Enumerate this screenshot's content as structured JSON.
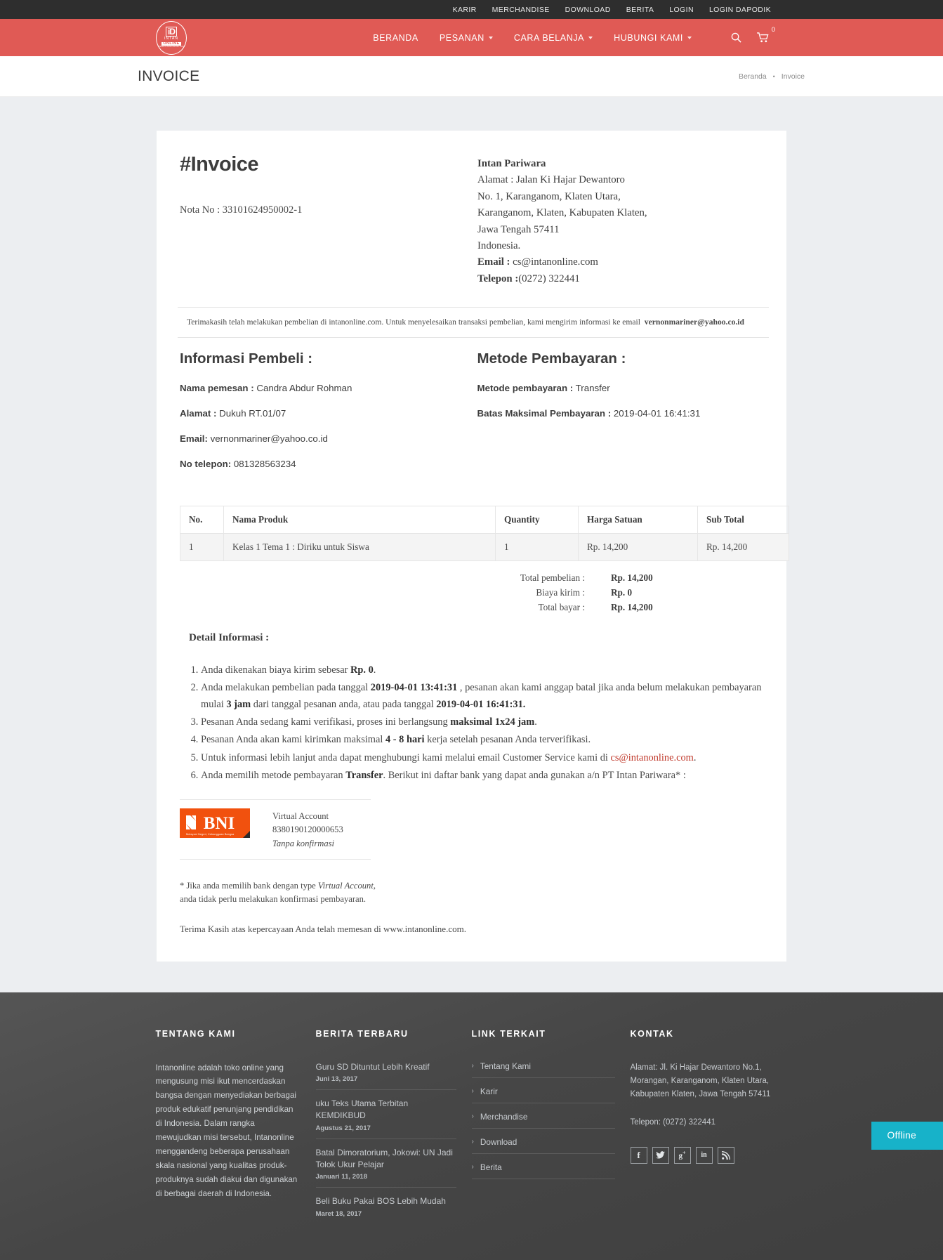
{
  "topbar": {
    "links": [
      "KARIR",
      "MERCHANDISE",
      "DOWNLOAD",
      "BERITA",
      "LOGIN",
      "LOGIN DAPODIK"
    ]
  },
  "navbar": {
    "logo": {
      "mark": "iD",
      "line1": "INTAN",
      "line2": "ONLINE",
      "line3": "WWW.INTANONLINE.COM"
    },
    "menu": [
      {
        "label": "BERANDA",
        "caret": false
      },
      {
        "label": "PESANAN",
        "caret": true
      },
      {
        "label": "CARA BELANJA",
        "caret": true
      },
      {
        "label": "HUBUNGI KAMI",
        "caret": true
      }
    ],
    "search_icon": "search-icon",
    "cart_icon": "cart-icon",
    "cart_count": "0"
  },
  "pagehead": {
    "title": "INVOICE",
    "breadcrumb_home": "Beranda",
    "breadcrumb_sep": "•",
    "breadcrumb_current": "Invoice"
  },
  "invoice": {
    "heading": "#Invoice",
    "nota": "Nota No : 33101624950002-1",
    "company": {
      "name": "Intan Pariwara",
      "address_line1": "Alamat : Jalan Ki Hajar Dewantoro",
      "address_line2": "No. 1, Karanganom, Klaten Utara,",
      "address_line3": "Karanganom, Klaten, Kabupaten Klaten,",
      "address_line4": "Jawa Tengah 57411",
      "address_line5": "Indonesia.",
      "email_label": "Email :",
      "email_value": " cs@intanonline.com",
      "phone_label": "Telepon :",
      "phone_value": "(0272) 322441"
    },
    "thanks_text": "Terimakasih telah melakukan pembelian di intanonline.com. Untuk menyelesaikan transaksi pembelian, kami mengirim informasi ke email",
    "thanks_email": "vernonmariner@yahoo.co.id",
    "buyer": {
      "heading": "Informasi Pembeli :",
      "name_label": "Nama pemesan :",
      "name_value": " Candra Abdur Rohman",
      "address_label": "Alamat :",
      "address_value": " Dukuh RT.01/07",
      "email_label": "Email:",
      "email_value": " vernonmariner@yahoo.co.id",
      "phone_label": "No telepon:",
      "phone_value": " 081328563234"
    },
    "payment": {
      "heading": "Metode Pembayaran :",
      "method_label": "Metode pembayaran :",
      "method_value": " Transfer",
      "deadline_label": "Batas Maksimal Pembayaran :",
      "deadline_value": " 2019-04-01 16:41:31"
    },
    "table": {
      "headers": [
        "No.",
        "Nama Produk",
        "Quantity",
        "Harga Satuan",
        "Sub Total"
      ],
      "rows": [
        {
          "no": "1",
          "produk": "Kelas 1 Tema 1 : Diriku untuk Siswa",
          "qty": "1",
          "harga": "Rp. 14,200",
          "subtotal": "Rp. 14,200"
        }
      ]
    },
    "totals": [
      {
        "label": "Total pembelian :",
        "value": "Rp. 14,200"
      },
      {
        "label": "Biaya kirim :",
        "value": "Rp. 0"
      },
      {
        "label": "Total bayar :",
        "value": "Rp. 14,200"
      }
    ],
    "detail_heading": "Detail Informasi :",
    "details": {
      "item1_a": "Anda dikenakan biaya kirim sebesar ",
      "item1_b": "Rp. 0",
      "item1_c": ".",
      "item2_a": "Anda melakukan pembelian pada tanggal ",
      "item2_b": "2019-04-01 13:41:31",
      "item2_c": " , pesanan akan kami anggap batal jika anda belum melakukan pembayaran mulai ",
      "item2_d": "3 jam",
      "item2_e": " dari tanggal pesanan anda, atau pada tanggal ",
      "item2_f": "2019-04-01 16:41:31.",
      "item3_a": "Pesanan Anda sedang kami verifikasi, proses ini berlangsung ",
      "item3_b": "maksimal 1x24 jam",
      "item3_c": ".",
      "item4_a": "Pesanan Anda akan kami kirimkan maksimal ",
      "item4_b": "4 - 8 hari",
      "item4_c": " kerja setelah pesanan Anda terverifikasi.",
      "item5_a": "Untuk informasi lebih lanjut anda dapat menghubungi kami melalui email Customer Service kami di ",
      "item5_link": "cs@intanonline.com",
      "item5_c": ".",
      "item6_a": "Anda memilih metode pembayaran ",
      "item6_b": "Transfer",
      "item6_c": ". Berikut ini daftar bank yang dapat anda gunakan a/n PT Intan Pariwara* :"
    },
    "bank": {
      "logo_text": "BNI",
      "logo_tagline": "Melayani Negeri, Kebanggaan Bangsa",
      "type": "Virtual Account",
      "account_number": "8380190120000653",
      "note": "Tanpa konfirmasi"
    },
    "footnote_line1_a": "* Jika anda memilih bank dengan type ",
    "footnote_line1_i": "Virtual Account",
    "footnote_line1_b": ",",
    "footnote_line2": "anda tidak perlu melakukan konfirmasi pembayaran.",
    "closing": "Terima Kasih atas kepercayaan Anda telah memesan di www.intanonline.com."
  },
  "footer": {
    "about": {
      "heading": "TENTANG KAMI",
      "text": "Intanonline adalah toko online yang mengusung misi ikut mencerdaskan bangsa dengan menyediakan berbagai produk edukatif penunjang pendidikan di Indonesia. Dalam rangka mewujudkan misi tersebut, Intanonline menggandeng beberapa perusahaan skala nasional yang kualitas produk-produknya sudah diakui dan digunakan di berbagai daerah di Indonesia."
    },
    "news": {
      "heading": "BERITA TERBARU",
      "items": [
        {
          "title": "Guru SD Dituntut Lebih Kreatif",
          "date": "Juni 13, 2017"
        },
        {
          "title": "uku Teks Utama Terbitan KEMDIKBUD",
          "date": "Agustus 21, 2017"
        },
        {
          "title": "Batal Dimoratorium, Jokowi: UN Jadi Tolok Ukur Pelajar",
          "date": "Januari 11, 2018"
        },
        {
          "title": "Beli Buku Pakai BOS Lebih Mudah",
          "date": "Maret 18, 2017"
        }
      ]
    },
    "links": {
      "heading": "LINK TERKAIT",
      "items": [
        "Tentang Kami",
        "Karir",
        "Merchandise",
        "Download",
        "Berita"
      ]
    },
    "contact": {
      "heading": "KONTAK",
      "address_line1": "Alamat: Jl. Ki Hajar Dewantoro No.1,",
      "address_line2": "Morangan, Karanganom, Klaten Utara,",
      "address_line3": "Kabupaten Klaten, Jawa Tengah 57411",
      "phone": "Telepon: (0272) 322441",
      "socials": [
        "facebook-icon",
        "twitter-icon",
        "google-plus-icon",
        "linkedin-icon",
        "rss-icon"
      ]
    }
  },
  "chat_widget": {
    "label": "Offline"
  },
  "colors": {
    "brand_red": "#e05a55",
    "topbar_dark": "#2e2e2e",
    "footer_dark": "#4a4a4a",
    "bni_orange": "#f1510e",
    "offline_teal": "#17b2c9",
    "link_red": "#c0392b"
  }
}
